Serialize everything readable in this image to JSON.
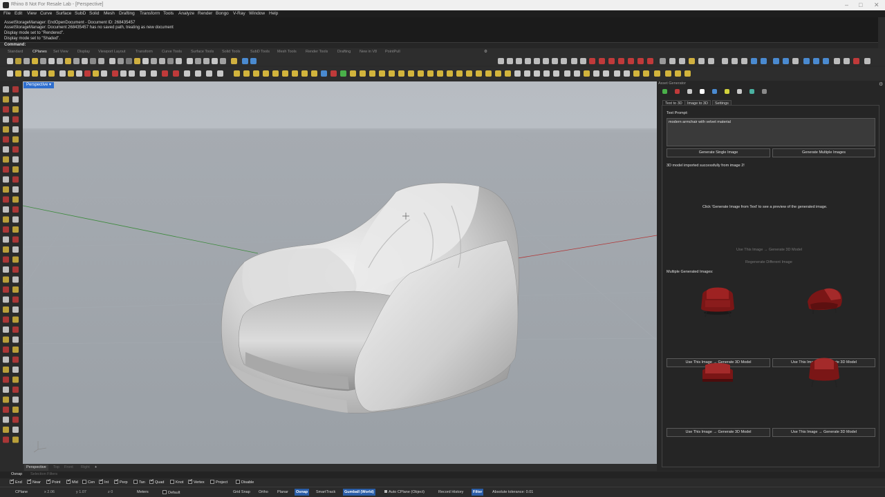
{
  "window": {
    "title": "Rhino 8 Not For Resale Lab - [Perspective]"
  },
  "menu": [
    "File",
    "Edit",
    "View",
    "Curve",
    "Surface",
    "SubD",
    "Solid",
    "Mesh",
    "Drafting",
    "Transform",
    "Tools",
    "Analyze",
    "Render",
    "Bongo",
    "V-Ray",
    "Window",
    "Help"
  ],
  "command_history": [
    "AssetStorageManager: EndOpenDocument - Document ID: 268435457",
    "AssetStorageManager: Document 268435457 has no saved path, treating as new document",
    "Display mode set to \"Rendered\".",
    "Display mode set to \"Shaded\"."
  ],
  "command_prompt": "Command:",
  "toolbar_tabs": [
    "Standard",
    "CPlanes",
    "Set View",
    "Display",
    "Viewport Layout",
    "Transform",
    "Curve Tools",
    "Surface Tools",
    "Solid Tools",
    "SubD Tools",
    "Mesh Tools",
    "Render Tools",
    "Drafting",
    "New in V8",
    "PointPull"
  ],
  "active_toolbar_tab": "CPlanes",
  "viewport": {
    "label": "Perspective",
    "tabs": [
      "Perspective",
      "Top",
      "Front",
      "Right"
    ],
    "add_tab": "+"
  },
  "panel": {
    "title": "Asset Generator",
    "tabs": [
      "Text to 3D",
      "Image to 3D",
      "Settings"
    ],
    "prompt_label": "Text Prompt:",
    "prompt_value": "modern armchair with velvet material",
    "generate_single": "Generate Single Image",
    "generate_multiple": "Generate Multiple Images",
    "status": "3D model imported successfully from image 2!",
    "preview_hint": "Click 'Generate Image from Text' to see a preview of the generated image.",
    "use_image_disabled": "Use This Image → Generate 3D Model",
    "regenerate_disabled": "Regenerate Different Image",
    "multiple_label": "Multiple Generated Images:",
    "use_image_button": "Use This Image → Generate 3D Model"
  },
  "osnap": {
    "tabs": [
      "Osnap",
      "Selection Filters"
    ],
    "items": [
      {
        "label": "End",
        "checked": true
      },
      {
        "label": "Near",
        "checked": true
      },
      {
        "label": "Point",
        "checked": true
      },
      {
        "label": "Mid",
        "checked": true
      },
      {
        "label": "Cen",
        "checked": false
      },
      {
        "label": "Int",
        "checked": true
      },
      {
        "label": "Perp",
        "checked": true
      },
      {
        "label": "Tan",
        "checked": false
      },
      {
        "label": "Quad",
        "checked": true
      },
      {
        "label": "Knot",
        "checked": false
      },
      {
        "label": "Vertex",
        "checked": true
      },
      {
        "label": "Project",
        "checked": false
      },
      {
        "label": "Disable",
        "checked": false
      }
    ]
  },
  "statusbar": {
    "cplane": "CPlane",
    "x": "x 2.06",
    "y": "y 1.07",
    "z": "z 0",
    "units": "Meters",
    "layer": "Default",
    "grid_snap": "Grid Snap",
    "ortho": "Ortho",
    "planar": "Planar",
    "osnap": "Osnap",
    "smarttrack": "SmartTrack",
    "gumball": "Gumball (World)",
    "auto_cplane": "Auto CPlane (Object)",
    "record_history": "Record History",
    "filter": "Filter",
    "tolerance": "Absolute tolerance: 0.01"
  }
}
